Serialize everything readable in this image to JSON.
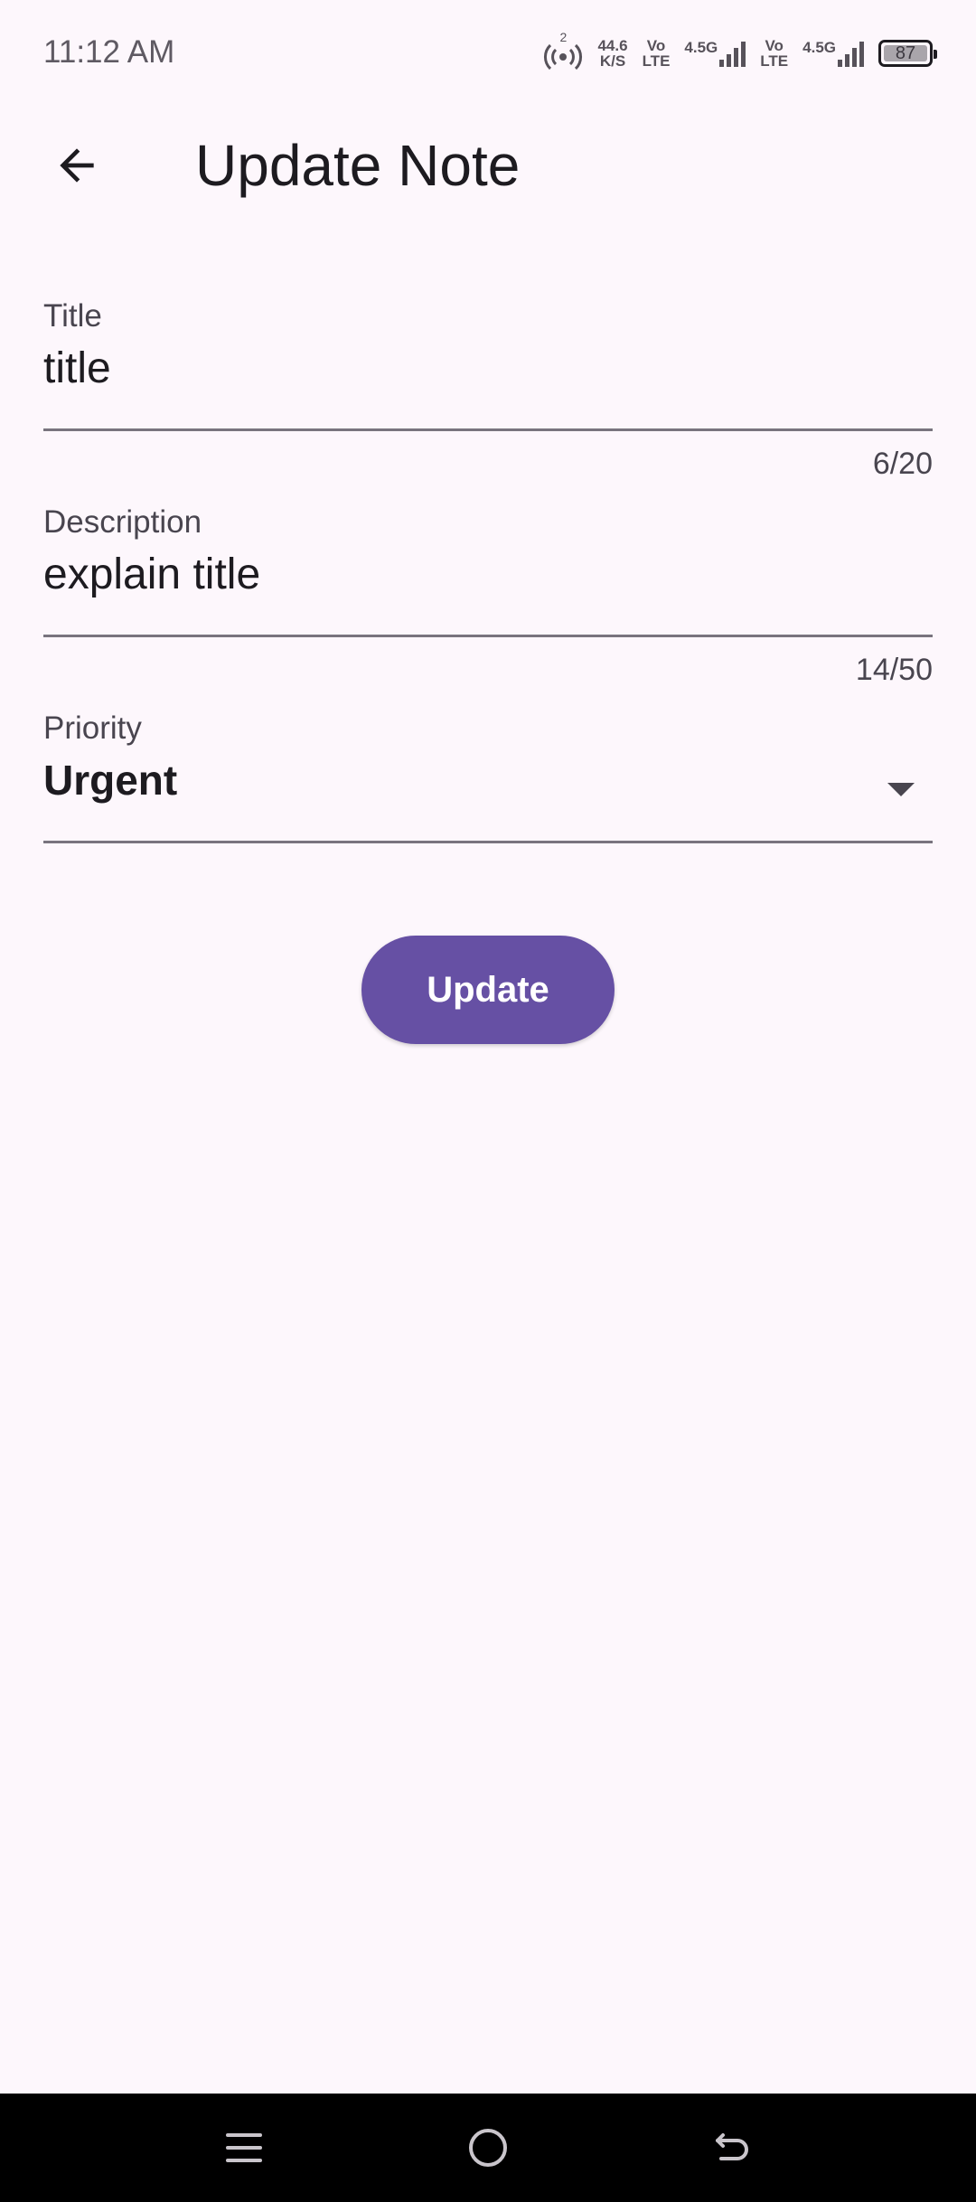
{
  "status_bar": {
    "time": "11:12 AM",
    "network_speed_value": "44.6",
    "network_speed_unit": "K/S",
    "hotspot_count": "2",
    "sim1_volte_top": "Vo",
    "sim1_volte_bottom": "LTE",
    "sim1_network": "4.5G",
    "sim2_volte_top": "Vo",
    "sim2_volte_bottom": "LTE",
    "sim2_network": "4.5G",
    "battery_level": "87"
  },
  "app_bar": {
    "title": "Update Note",
    "back_icon": "arrow-back-icon"
  },
  "form": {
    "title_field": {
      "label": "Title",
      "value": "title",
      "counter": "6/20"
    },
    "description_field": {
      "label": "Description",
      "value": "explain title",
      "counter": "14/50"
    },
    "priority_field": {
      "label": "Priority",
      "selected": "Urgent",
      "icon": "dropdown-arrow-icon"
    },
    "update_button": {
      "label": "Update",
      "color": "#6650a4"
    }
  },
  "nav_bar": {
    "menu_icon": "menu-icon",
    "home_icon": "home-icon",
    "back_icon": "back-icon"
  },
  "colors": {
    "background": "#fdf7fc",
    "accent": "#6650a4",
    "text": "#1d1b20"
  }
}
